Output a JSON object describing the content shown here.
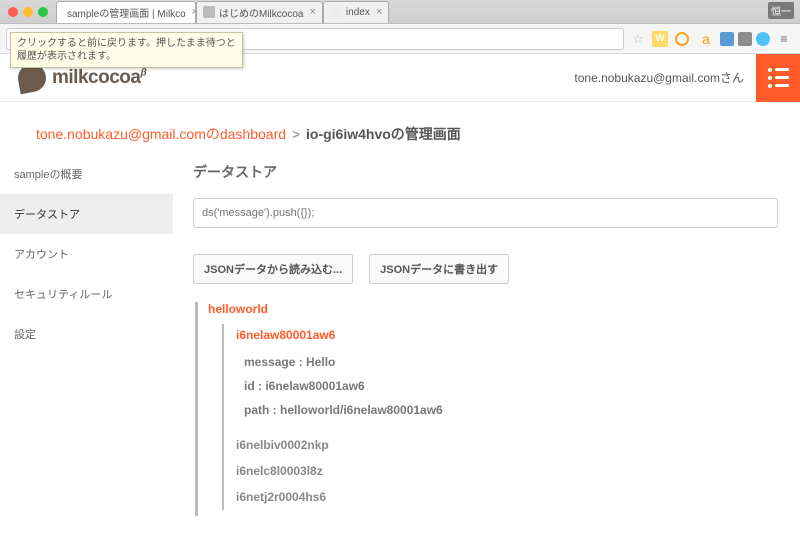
{
  "browser": {
    "tabs": [
      {
        "label": "sampleの管理画面 | Milkco"
      },
      {
        "label": "はじめのMilkcocoa"
      },
      {
        "label": "index"
      }
    ],
    "url": "age/#io-gi6iw4hvo",
    "tooltip": "クリックすると前に戻ります。押したまま待つと\n履歴が表示されます。",
    "persona": "恒一"
  },
  "header": {
    "logo": "milkcocoa",
    "user": "tone.nobukazu@gmail.comさん"
  },
  "breadcrumb": {
    "link": "tone.nobukazu@gmail.comのdashboard",
    "sep": ">",
    "current": "io-gi6iw4hvoの管理画面"
  },
  "sidebar": {
    "items": [
      {
        "label": "sampleの概要"
      },
      {
        "label": "データストア"
      },
      {
        "label": "アカウント"
      },
      {
        "label": "セキュリティルール"
      },
      {
        "label": "設定"
      }
    ],
    "activeIndex": 1
  },
  "main": {
    "title": "データストア",
    "input_placeholder": "ds('message').push({});",
    "btn_load": "JSONデータから読み込む...",
    "btn_export": "JSONデータに書き出す",
    "tree": {
      "root": "helloworld",
      "record_id": "i6nelaw80001aw6",
      "props": {
        "message": "message : Hello",
        "id": "id : i6nelaw80001aw6",
        "path": "path : helloworld/i6nelaw80001aw6"
      },
      "siblings": [
        "i6nelbiv0002nkp",
        "i6nelc8l0003l8z",
        "i6netj2r0004hs6"
      ]
    }
  }
}
